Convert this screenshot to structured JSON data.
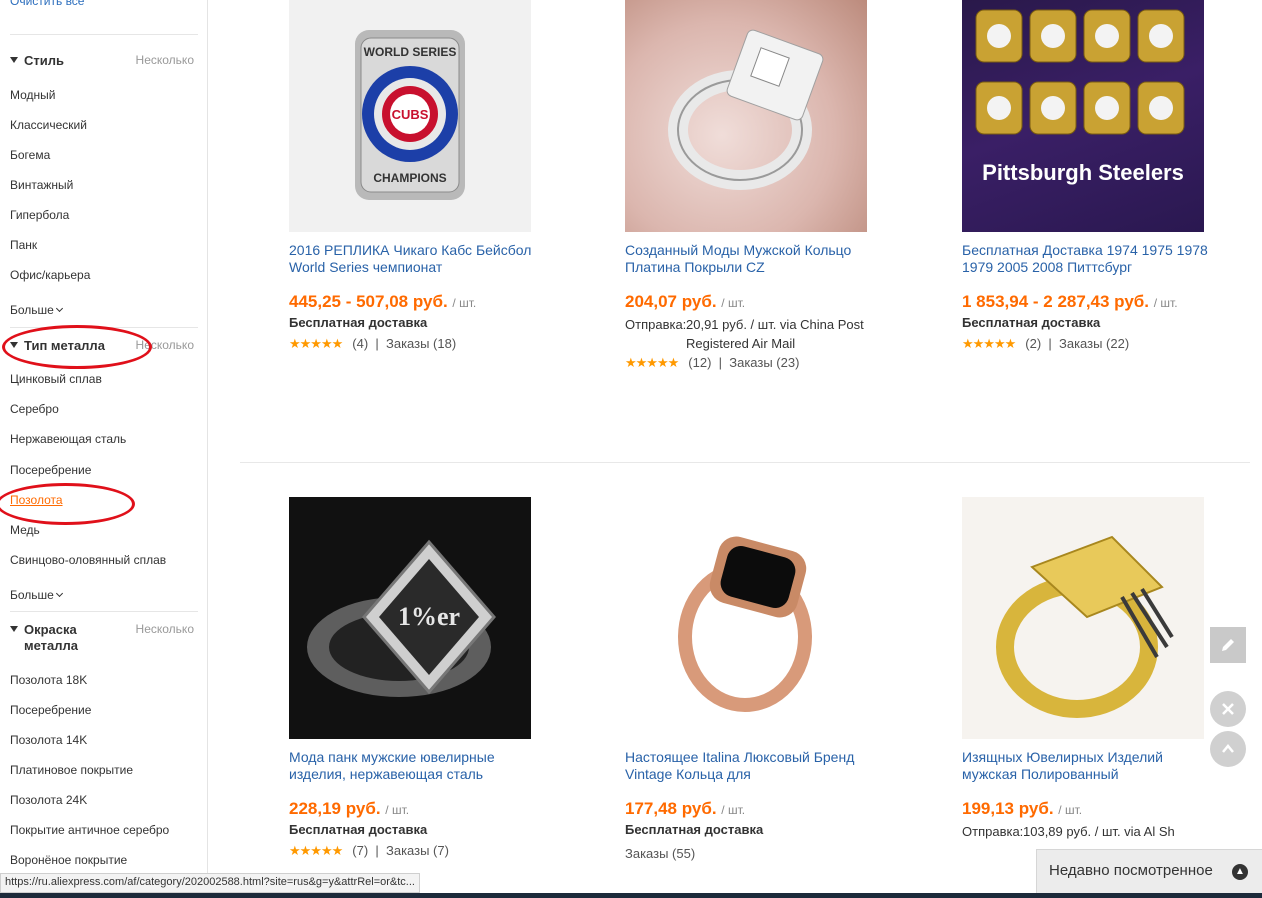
{
  "sidebar": {
    "clear_all": "Очистить все",
    "groups": [
      {
        "title": "Стиль",
        "multi": "Несколько",
        "items": [
          "Модный",
          "Классический",
          "Богема",
          "Винтажный",
          "Гипербола",
          "Панк",
          "Офис/карьера"
        ],
        "more": "Больше"
      },
      {
        "title": "Тип металла",
        "multi": "Несколько",
        "items": [
          "Цинковый сплав",
          "Серебро",
          "Нержавеющая сталь",
          "Посеребрение",
          "Позолота",
          "Медь",
          "Свинцово-оловянный сплав"
        ],
        "more": "Больше"
      },
      {
        "title": "Окраска металла",
        "multi": "Несколько",
        "items": [
          "Позолота 18K",
          "Посеребрение",
          "Позолота 14K",
          "Платиновое покрытие",
          "Позолота 24K",
          "Покрытие античное серебро",
          "Воронёное покрытие"
        ]
      }
    ]
  },
  "products": [
    {
      "title": "2016 РЕПЛИКА Чикаго Кабс Бейсбол World Series чемпионат",
      "price": "445,25 - 507,08 руб.",
      "unit": "/ шт.",
      "shipping": "Бесплатная доставка",
      "stars": "★★★★★",
      "reviews": "(4)",
      "orders": "Заказы (18)",
      "image_text_top": "WORLD SERIES",
      "image_text_mid": "CUBS",
      "image_text_bot": "CHAMPIONS"
    },
    {
      "title": "Созданный Моды Мужской Кольцо Платина Покрыли CZ",
      "price": "204,07 руб.",
      "unit": "/ шт.",
      "shipping_label": "Отправка:",
      "shipping_rest": "20,91 руб. / шт. via China Post Registered Air Mail",
      "stars": "★★★★★",
      "reviews": "(12)",
      "orders": "Заказы (23)"
    },
    {
      "title": "Бесплатная Доставка 1974 1975 1978 1979 2005 2008 Питтсбург",
      "price": "1 853,94 - 2 287,43 руб.",
      "unit": "/ шт.",
      "shipping": "Бесплатная доставка",
      "stars": "★★★★★",
      "reviews": "(2)",
      "orders": "Заказы (22)",
      "image_text": "Pittsburgh Steelers"
    },
    {
      "title": "Мода панк мужские ювелирные изделия, нержавеющая сталь",
      "price": "228,19 руб.",
      "unit": "/ шт.",
      "shipping": "Бесплатная доставка",
      "stars": "★★★★★",
      "reviews": "(7)",
      "orders": "Заказы (7)",
      "image_text": "1%er"
    },
    {
      "title": "Настоящее Italina Люксовый Бренд Vintage Кольца для",
      "price": "177,48 руб.",
      "unit": "/ шт.",
      "shipping": "Бесплатная доставка",
      "orders": "Заказы (55)"
    },
    {
      "title": "Изящных Ювелирных Изделий мужская Полированный",
      "price": "199,13 руб.",
      "unit": "/ шт.",
      "shipping_label": "Отправка:",
      "shipping_rest": "103,89 руб. / шт. via Al Sh"
    }
  ],
  "recently_viewed": "Недавно посмотренное",
  "status_url": "https://ru.aliexpress.com/af/category/202002588.html?site=rus&g=y&attrRel=or&tc...",
  "colors": {
    "accent_orange": "#ff6a00",
    "link_blue": "#2962a8",
    "annotation_red": "#e0101a"
  }
}
